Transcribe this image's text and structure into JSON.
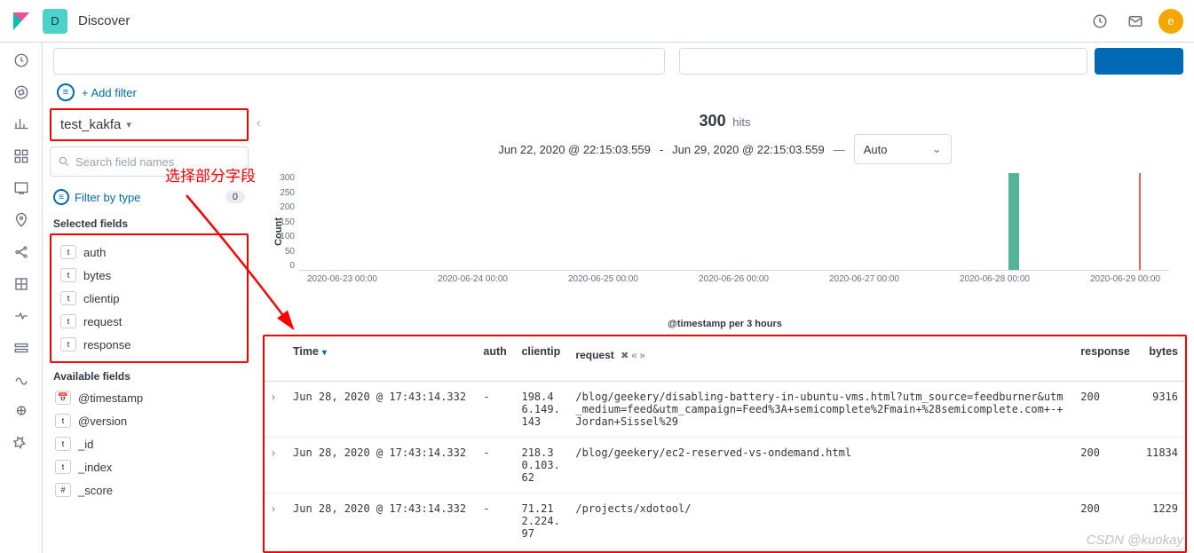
{
  "header": {
    "app_title": "Discover",
    "space_letter": "D",
    "user_letter": "e"
  },
  "filterbar": {
    "add_filter": "+ Add filter"
  },
  "sidebar": {
    "index_pattern": "test_kakfa",
    "search_placeholder": "Search field names",
    "filter_type_label": "Filter by type",
    "filter_type_count": "0",
    "selected_label": "Selected fields",
    "available_label": "Available fields",
    "selected": [
      {
        "type": "t",
        "name": "auth"
      },
      {
        "type": "t",
        "name": "bytes"
      },
      {
        "type": "t",
        "name": "clientip"
      },
      {
        "type": "t",
        "name": "request"
      },
      {
        "type": "t",
        "name": "response"
      }
    ],
    "available": [
      {
        "type": "date",
        "name": "@timestamp"
      },
      {
        "type": "t",
        "name": "@version"
      },
      {
        "type": "t",
        "name": "_id"
      },
      {
        "type": "t",
        "name": "_index"
      },
      {
        "type": "num",
        "name": "_score"
      }
    ]
  },
  "annotation": {
    "label": "选择部分字段"
  },
  "hits": {
    "count": "300",
    "label": "hits"
  },
  "timerange": {
    "from": "Jun 22, 2020 @ 22:15:03.559",
    "to": "Jun 29, 2020 @ 22:15:03.559",
    "interval": "Auto"
  },
  "chart_data": {
    "type": "bar",
    "ylabel": "Count",
    "xlabel": "@timestamp per 3 hours",
    "y_ticks": [
      "300",
      "250",
      "200",
      "150",
      "100",
      "50",
      "0"
    ],
    "x_ticks": [
      "2020-06-23 00:00",
      "2020-06-24 00:00",
      "2020-06-25 00:00",
      "2020-06-26 00:00",
      "2020-06-27 00:00",
      "2020-06-28 00:00",
      "2020-06-29 00:00"
    ],
    "series": [
      {
        "name": "main",
        "color": "#54b399",
        "values": [
          {
            "x": "2020-06-28 18:00",
            "y": 300
          }
        ]
      },
      {
        "name": "marker",
        "color": "#e7664c",
        "values": [
          {
            "x": "2020-06-29 21:00",
            "y": 300
          }
        ]
      }
    ],
    "ylim": [
      0,
      300
    ]
  },
  "table": {
    "headers": {
      "time": "Time",
      "auth": "auth",
      "clientip": "clientip",
      "request": "request",
      "response": "response",
      "bytes": "bytes",
      "request_sub_controls": "✖ « »"
    },
    "rows": [
      {
        "time": "Jun 28, 2020 @ 17:43:14.332",
        "auth": "-",
        "clientip": "198.46.149.143",
        "request": "/blog/geekery/disabling-battery-in-ubuntu-vms.html?utm_source=feedburner&utm_medium=feed&utm_campaign=Feed%3A+semicomplete%2Fmain+%28semicomplete.com+-+Jordan+Sissel%29",
        "response": "200",
        "bytes": "9316"
      },
      {
        "time": "Jun 28, 2020 @ 17:43:14.332",
        "auth": "-",
        "clientip": "218.30.103.62",
        "request": "/blog/geekery/ec2-reserved-vs-ondemand.html",
        "response": "200",
        "bytes": "11834"
      },
      {
        "time": "Jun 28, 2020 @ 17:43:14.332",
        "auth": "-",
        "clientip": "71.212.224.97",
        "request": "/projects/xdotool/",
        "response": "200",
        "bytes": "1229"
      }
    ]
  },
  "watermark": "CSDN @kuokay"
}
